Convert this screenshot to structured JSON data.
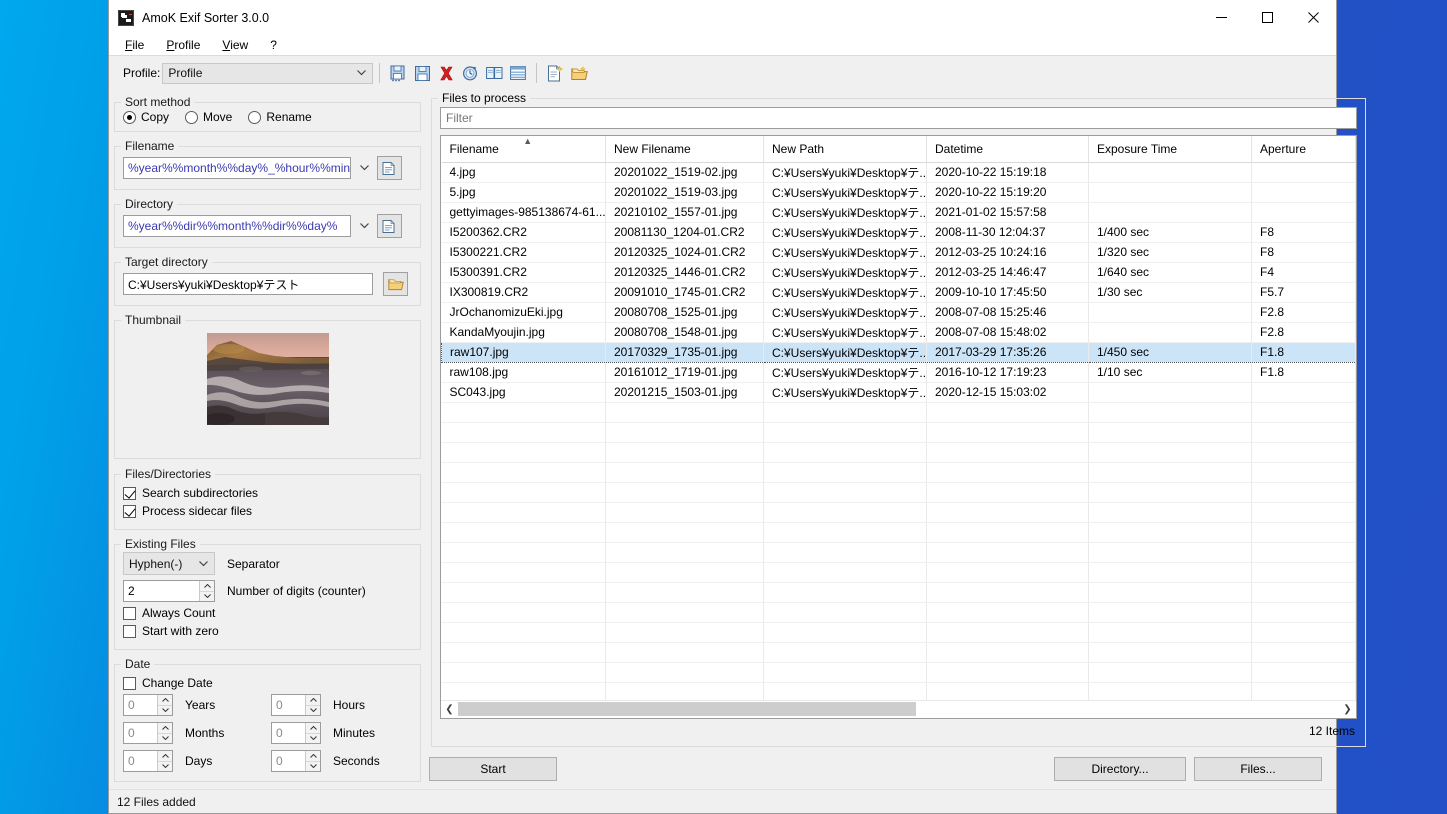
{
  "window": {
    "title": "AmoK Exif Sorter 3.0.0",
    "icon": "app-icon",
    "controls": {
      "minimize": "minimize",
      "maximize": "maximize",
      "close": "close"
    }
  },
  "menu": {
    "items": [
      {
        "label": "File",
        "accel": "F"
      },
      {
        "label": "Profile",
        "accel": "P"
      },
      {
        "label": "View",
        "accel": "V"
      },
      {
        "label": "?",
        "accel": ""
      }
    ]
  },
  "toolbar": {
    "profile_label": "Profile:",
    "profile_value": "Profile",
    "icons": [
      "save-as-icon",
      "save-icon",
      "delete-icon",
      "clock-icon",
      "book-icon",
      "list-icon",
      "new-profile-icon",
      "open-folder-icon"
    ]
  },
  "sort_method": {
    "legend": "Sort method",
    "options": [
      "Copy",
      "Move",
      "Rename"
    ],
    "selected": "Copy"
  },
  "filename": {
    "legend": "Filename",
    "value": "%year%%month%%day%_%hour%%min",
    "button": "pattern-editor-icon"
  },
  "directory": {
    "legend": "Directory",
    "value": "%year%%dir%%month%%dir%%day%",
    "button": "pattern-editor-icon"
  },
  "target_directory": {
    "legend": "Target directory",
    "value": "C:¥Users¥yuki¥Desktop¥テスト",
    "button": "browse-folder-icon"
  },
  "thumbnail": {
    "legend": "Thumbnail",
    "alt": "coastal sunset seascape thumbnail"
  },
  "files_directories": {
    "legend": "Files/Directories",
    "checkboxes": [
      {
        "label": "Search subdirectories",
        "checked": true
      },
      {
        "label": "Process sidecar files",
        "checked": true
      }
    ]
  },
  "existing_files": {
    "legend": "Existing Files",
    "separator_value": "Hyphen(-)",
    "separator_label": "Separator",
    "digits_value": "2",
    "digits_label": "Number of digits (counter)",
    "checkboxes": [
      {
        "label": "Always Count",
        "checked": false
      },
      {
        "label": "Start with zero",
        "checked": false
      }
    ]
  },
  "date": {
    "legend": "Date",
    "change_date_label": "Change Date",
    "change_date_checked": false,
    "fields": [
      {
        "label": "Years",
        "value": "0"
      },
      {
        "label": "Hours",
        "value": "0"
      },
      {
        "label": "Months",
        "value": "0"
      },
      {
        "label": "Minutes",
        "value": "0"
      },
      {
        "label": "Days",
        "value": "0"
      },
      {
        "label": "Seconds",
        "value": "0"
      }
    ]
  },
  "files_panel": {
    "legend": "Files to process",
    "filter_placeholder": "Filter",
    "filter_value": "",
    "columns": [
      "Filename",
      "New Filename",
      "New Path",
      "Datetime",
      "Exposure Time",
      "Aperture"
    ],
    "sort_column": "Filename",
    "sort_direction": "ascending",
    "rows": [
      {
        "filename": "4.jpg",
        "new_filename": "20201022_1519-02.jpg",
        "new_path": "C:¥Users¥yuki¥Desktop¥テ...",
        "datetime": "2020-10-22 15:19:18",
        "exposure": "",
        "aperture": "",
        "selected": false
      },
      {
        "filename": "5.jpg",
        "new_filename": "20201022_1519-03.jpg",
        "new_path": "C:¥Users¥yuki¥Desktop¥テ...",
        "datetime": "2020-10-22 15:19:20",
        "exposure": "",
        "aperture": "",
        "selected": false
      },
      {
        "filename": "gettyimages-985138674-61...",
        "new_filename": "20210102_1557-01.jpg",
        "new_path": "C:¥Users¥yuki¥Desktop¥テ...",
        "datetime": "2021-01-02 15:57:58",
        "exposure": "",
        "aperture": "",
        "selected": false
      },
      {
        "filename": "I5200362.CR2",
        "new_filename": "20081130_1204-01.CR2",
        "new_path": "C:¥Users¥yuki¥Desktop¥テ...",
        "datetime": "2008-11-30 12:04:37",
        "exposure": "1/400 sec",
        "aperture": "F8",
        "selected": false
      },
      {
        "filename": "I5300221.CR2",
        "new_filename": "20120325_1024-01.CR2",
        "new_path": "C:¥Users¥yuki¥Desktop¥テ...",
        "datetime": "2012-03-25 10:24:16",
        "exposure": "1/320 sec",
        "aperture": "F8",
        "selected": false
      },
      {
        "filename": "I5300391.CR2",
        "new_filename": "20120325_1446-01.CR2",
        "new_path": "C:¥Users¥yuki¥Desktop¥テ...",
        "datetime": "2012-03-25 14:46:47",
        "exposure": "1/640 sec",
        "aperture": "F4",
        "selected": false
      },
      {
        "filename": "IX300819.CR2",
        "new_filename": "20091010_1745-01.CR2",
        "new_path": "C:¥Users¥yuki¥Desktop¥テ...",
        "datetime": "2009-10-10 17:45:50",
        "exposure": "1/30 sec",
        "aperture": "F5.7",
        "selected": false
      },
      {
        "filename": "JrOchanomizuEki.jpg",
        "new_filename": "20080708_1525-01.jpg",
        "new_path": "C:¥Users¥yuki¥Desktop¥テ...",
        "datetime": "2008-07-08 15:25:46",
        "exposure": "",
        "aperture": "F2.8",
        "selected": false
      },
      {
        "filename": "KandaMyoujin.jpg",
        "new_filename": "20080708_1548-01.jpg",
        "new_path": "C:¥Users¥yuki¥Desktop¥テ...",
        "datetime": "2008-07-08 15:48:02",
        "exposure": "",
        "aperture": "F2.8",
        "selected": false
      },
      {
        "filename": "raw107.jpg",
        "new_filename": "20170329_1735-01.jpg",
        "new_path": "C:¥Users¥yuki¥Desktop¥テ...",
        "datetime": "2017-03-29 17:35:26",
        "exposure": "1/450 sec",
        "aperture": "F1.8",
        "selected": true
      },
      {
        "filename": "raw108.jpg",
        "new_filename": "20161012_1719-01.jpg",
        "new_path": "C:¥Users¥yuki¥Desktop¥テ...",
        "datetime": "2016-10-12 17:19:23",
        "exposure": "1/10 sec",
        "aperture": "F1.8",
        "selected": false
      },
      {
        "filename": "SC043.jpg",
        "new_filename": "20201215_1503-01.jpg",
        "new_path": "C:¥Users¥yuki¥Desktop¥テ...",
        "datetime": "2020-12-15 15:03:02",
        "exposure": "",
        "aperture": "",
        "selected": false
      }
    ],
    "items_count": "12 Items"
  },
  "buttons": {
    "start": "Start",
    "directory": "Directory...",
    "files": "Files..."
  },
  "statusbar": {
    "text": "12 Files added"
  },
  "colors": {
    "selection": "#cce4f7",
    "pattern_text": "#3a3ab0",
    "window_bg": "#f0f0f0",
    "desktop_left": "#00a8ee",
    "desktop_right": "#1f4fc4"
  }
}
